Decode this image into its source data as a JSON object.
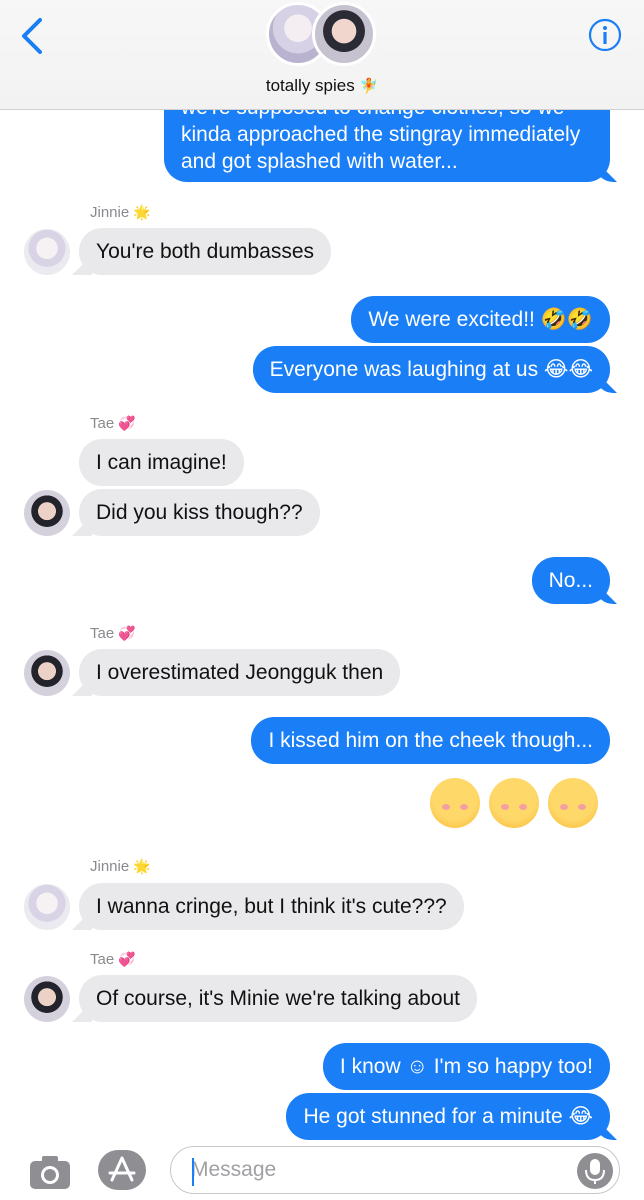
{
  "header": {
    "title": "totally spies",
    "title_emoji": "🧚",
    "back_icon": "chevron-left-icon",
    "info_icon": "info-icon"
  },
  "messages": [
    {
      "dir": "out",
      "text_lines": [
        "we're supposed to change clothes, so we",
        "kinda approached the stingray immediately",
        "and got splashed with water..."
      ]
    },
    {
      "dir": "in",
      "sender": "Jinnie",
      "sender_emoji": "🌟",
      "text": "You're both dumbasses"
    },
    {
      "dir": "out",
      "text": "We were excited!! 🤣🤣"
    },
    {
      "dir": "out",
      "text": "Everyone was laughing at us 😂😂"
    },
    {
      "dir": "in",
      "sender": "Tae",
      "sender_emoji": "💞",
      "text": "I can imagine!"
    },
    {
      "dir": "in",
      "text": "Did you kiss though??"
    },
    {
      "dir": "out",
      "text": "No..."
    },
    {
      "dir": "in",
      "sender": "Tae",
      "sender_emoji": "💞",
      "text": "I overestimated Jeongguk then"
    },
    {
      "dir": "out",
      "text": "I kissed him on the cheek though..."
    },
    {
      "dir": "out-emoji",
      "text": "☺☺☺"
    },
    {
      "dir": "in",
      "sender": "Jinnie",
      "sender_emoji": "🌟",
      "text": "I wanna cringe, but I think it's cute???"
    },
    {
      "dir": "in",
      "sender": "Tae",
      "sender_emoji": "💞",
      "text": "Of course, it's Minie we're talking about"
    },
    {
      "dir": "out",
      "text": "I know ☺ I'm so happy too!"
    },
    {
      "dir": "out",
      "text": "He got stunned for a minute 😂"
    }
  ],
  "input": {
    "placeholder": "Message",
    "camera_icon": "camera-icon",
    "apps_icon": "app-store-icon",
    "mic_icon": "microphone-icon"
  },
  "colors": {
    "accent": "#1a7ef7",
    "incoming": "#e9e9eb"
  }
}
